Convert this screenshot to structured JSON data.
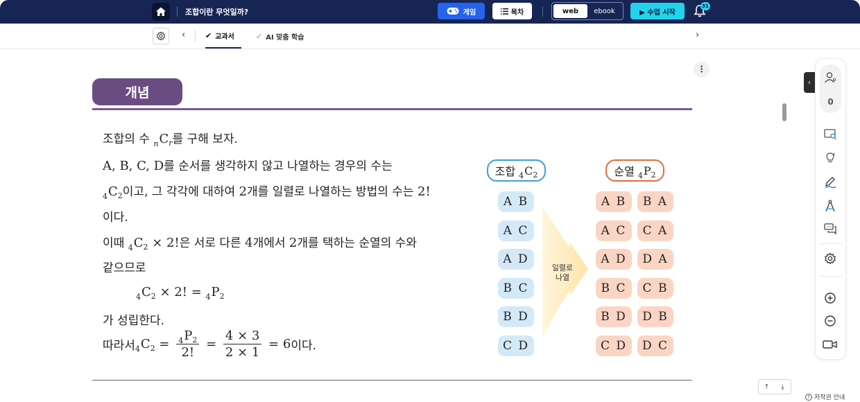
{
  "header": {
    "title": "조합이란 무엇일까?",
    "game_label": "게임",
    "toc_label": "목차",
    "view_modes": [
      "web",
      "ebook"
    ],
    "active_view": "web",
    "start_label": "▶ 수업 시작",
    "notification_count": "31"
  },
  "tabs": [
    {
      "label": "교과서",
      "active": true
    },
    {
      "label": "AI 맞춤 학습",
      "active": false
    }
  ],
  "content": {
    "section_label": "개념",
    "lines": {
      "l1_a": "조합의 수 ",
      "l1_C": "C",
      "l1_r": "r",
      "l1_n": "n",
      "l1_b": "를 구해 보자.",
      "l2_math": "A, B, C, D",
      "l2_text": "를 순서를 생각하지 않고 나열하는 경우의 수는",
      "l3_pre": "4",
      "l3_C": "C",
      "l3_sub": "2",
      "l3_text": "이고, 그 각각에 대하여 ",
      "l3_two": "2",
      "l3_text2": "개를 일렬로 나열하는 방법의 수는 ",
      "l3_fact": "2!",
      "l4": "이다.",
      "l5_a": "이때 ",
      "l5_pre": "4",
      "l5_C": "C",
      "l5_sub": "2",
      "l5_math": " × 2!",
      "l5_b": "은 서로 다른 ",
      "l5_four": "4",
      "l5_c": "개에서 ",
      "l5_two": "2",
      "l5_d": "개를 택하는 순열의 수와",
      "l6": "같으므로",
      "eq_pre1": "4",
      "eq_C": "C",
      "eq_sub1": "2",
      "eq_mid": " × 2! = ",
      "eq_pre2": "4",
      "eq_P": "P",
      "eq_sub2": "2",
      "l8": "가 성립한다.",
      "l9_a": "따라서 ",
      "l9_pre": "4",
      "l9_C": "C",
      "l9_sub": "2",
      "l9_eq": " = ",
      "l9_num_pre": "4",
      "l9_num_P": "P",
      "l9_num_sub": "2",
      "l9_den": "2!",
      "l9_eq2": " = ",
      "l9_num2": "4 × 3",
      "l9_den2": "2 × 1",
      "l9_eq3": " = 6",
      "l9_end": "이다."
    },
    "diagram": {
      "comb_title": "조합",
      "comb_pre": "4",
      "comb_C": "C",
      "comb_sub": "2",
      "perm_title": "순열",
      "perm_pre": "4",
      "perm_P": "P",
      "perm_sub": "2",
      "arrow_label": "일렬로\n나열",
      "combinations": [
        "A B",
        "A C",
        "A D",
        "B C",
        "B D",
        "C D"
      ],
      "permutations_1": [
        "A B",
        "A C",
        "A D",
        "B C",
        "B D",
        "C D"
      ],
      "permutations_2": [
        "B A",
        "C A",
        "D A",
        "C B",
        "D B",
        "D C"
      ]
    }
  },
  "sidebar": {
    "participant_count": "0"
  },
  "footer": {
    "copyright_label": "저작권 안내",
    "help_glyph": "?"
  },
  "colors": {
    "header_bg": "#172554",
    "game_btn": "#2563eb",
    "start_btn": "#22d3ee",
    "section_banner": "#6b4c82",
    "comb_border": "#3aa0d8",
    "perm_border": "#e86a3a",
    "comb_cell": "#d4e9f7",
    "perm_cell": "#fbd5c4"
  },
  "icons": [
    "home-icon",
    "gamepad-icon",
    "list-icon",
    "play-icon",
    "bell-icon",
    "gear-icon",
    "chevron-left-icon",
    "chevron-right-icon",
    "check-icon",
    "more-vertical-icon",
    "user-icon",
    "screen-search-icon",
    "lightbulb-icon",
    "pen-icon",
    "compass-icon",
    "chat-icon",
    "zoom-in-icon",
    "zoom-out-icon",
    "camera-icon",
    "arrow-up-icon",
    "arrow-down-icon",
    "help-icon"
  ]
}
